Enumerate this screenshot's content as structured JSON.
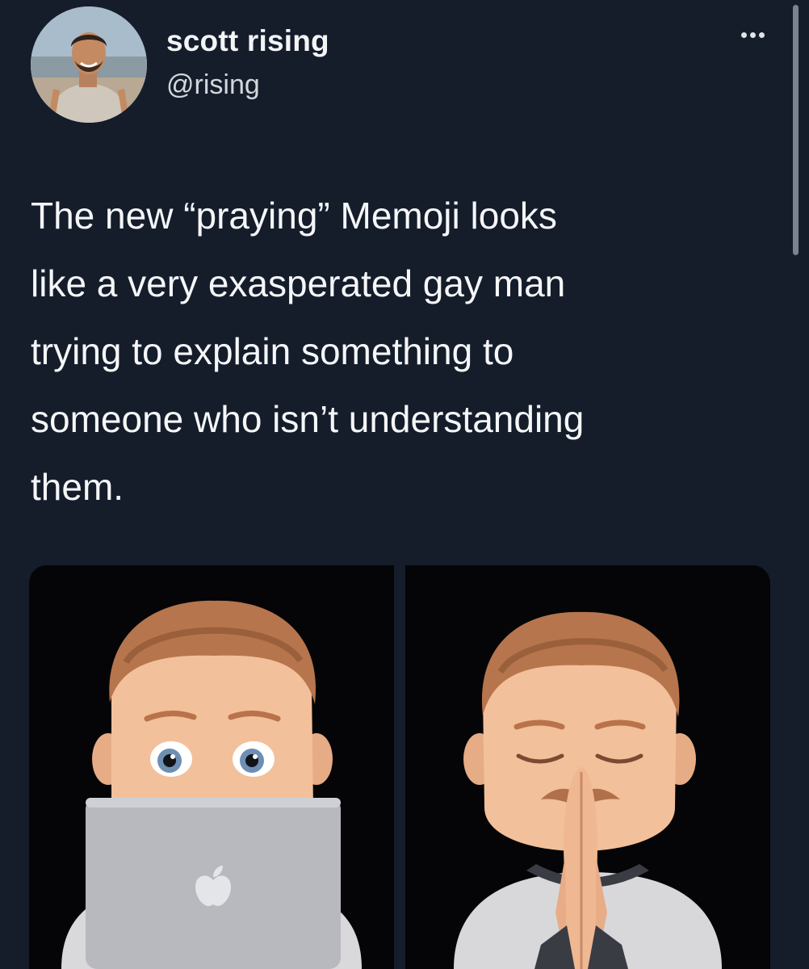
{
  "tweet": {
    "author": {
      "display_name": "scott rising",
      "handle": "@rising",
      "avatar_icon": "avatar-photo"
    },
    "more_icon": "more-horizontal-icon",
    "text": "The new “praying” Memoji looks\nlike a very exasperated gay man\ntrying to explain something to\nsomeone who isn’t understanding\nthem.",
    "media": [
      {
        "kind": "memoji-laptop",
        "icon": "apple-logo-icon"
      },
      {
        "kind": "memoji-praying"
      }
    ]
  },
  "colors": {
    "background": "#151d2b",
    "text": "#f5f6f8",
    "secondary_text": "#d3d7dc",
    "media_background": "#050507"
  }
}
